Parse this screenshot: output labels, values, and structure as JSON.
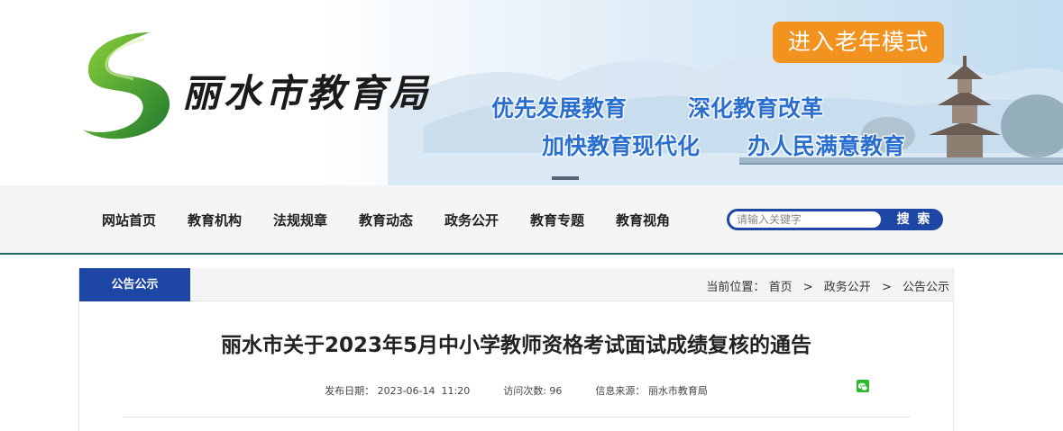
{
  "header": {
    "site_name": "丽水市教育局",
    "elder_mode_label": "进入老年模式",
    "slogans": [
      "优先发展教育",
      "深化教育改革",
      "加快教育现代化",
      "办人民满意教育"
    ]
  },
  "nav": {
    "items": [
      {
        "label": "网站首页"
      },
      {
        "label": "教育机构"
      },
      {
        "label": "法规规章"
      },
      {
        "label": "教育动态"
      },
      {
        "label": "政务公开"
      },
      {
        "label": "教育专题"
      },
      {
        "label": "教育视角"
      }
    ],
    "search": {
      "placeholder": "请输入关键字",
      "value": "",
      "button_label": "搜 索"
    }
  },
  "content": {
    "section_tab": "公告公示",
    "breadcrumb": {
      "prefix": "当前位置：",
      "items": [
        "首页",
        "政务公开",
        "公告公示"
      ],
      "separator": ">"
    },
    "article": {
      "title": "丽水市关于2023年5月中小学教师资格考试面试成绩复核的通告",
      "publish_label": "发布日期：",
      "publish_date": "2023-06-14  11:20",
      "visits_label": "访问次数:",
      "visits": "96",
      "source_label": "信息来源：",
      "source": "丽水市教育局"
    }
  },
  "icons": {
    "logo": "swirl-logo-icon",
    "wechat": "wechat-icon"
  },
  "colors": {
    "nav_blue": "#1e47a5",
    "elder_orange": "#f29320",
    "slogan_blue": "#2a6fd0",
    "nav_border": "#1d6b63",
    "logo_green": "#3a9a2a"
  }
}
